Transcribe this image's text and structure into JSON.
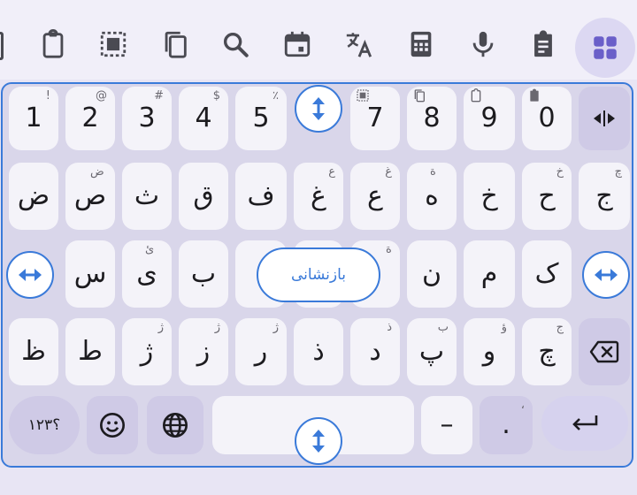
{
  "toolbar": {
    "items": [
      {
        "icon": "clipboard-icon"
      },
      {
        "icon": "select-all-icon"
      },
      {
        "icon": "copy-icon"
      },
      {
        "icon": "search-icon"
      },
      {
        "icon": "calendar-icon"
      },
      {
        "icon": "translate-icon"
      },
      {
        "icon": "calculator-icon"
      },
      {
        "icon": "microphone-icon"
      },
      {
        "icon": "clipboard-list-icon"
      },
      {
        "icon": "apps-grid-icon"
      }
    ]
  },
  "keyboard": {
    "row1": [
      {
        "main": "1",
        "hint": "!"
      },
      {
        "main": "2",
        "hint": "@"
      },
      {
        "main": "3",
        "hint": "#"
      },
      {
        "main": "4",
        "hint": "$"
      },
      {
        "main": "5",
        "hint": "٪"
      },
      {
        "main": "7",
        "hint_icon": "select-all-icon"
      },
      {
        "main": "8",
        "hint_icon": "copy-icon"
      },
      {
        "main": "9",
        "hint_icon": "clipboard-icon"
      },
      {
        "main": "0",
        "hint_icon": "clipboard-list-icon"
      }
    ],
    "row2": [
      {
        "main": "ض",
        "hint": ""
      },
      {
        "main": "ص",
        "hint": "ض"
      },
      {
        "main": "ث",
        "hint": ""
      },
      {
        "main": "ق",
        "hint": ""
      },
      {
        "main": "ف",
        "hint": ""
      },
      {
        "main": "غ",
        "hint": "ع"
      },
      {
        "main": "ع",
        "hint": "غ"
      },
      {
        "main": "ه",
        "hint": "ة"
      },
      {
        "main": "خ",
        "hint": ""
      },
      {
        "main": "ح",
        "hint": "خ"
      },
      {
        "main": "ج",
        "hint": "چ"
      }
    ],
    "row3": [
      {
        "main": "س",
        "hint": ""
      },
      {
        "main": "ی",
        "hint": "ئ"
      },
      {
        "main": "ب",
        "hint": ""
      },
      {
        "main": "ن",
        "hint": ""
      },
      {
        "main": "م",
        "hint": ""
      },
      {
        "main": "ک",
        "hint": ""
      }
    ],
    "row4": [
      {
        "main": "ظ",
        "hint": ""
      },
      {
        "main": "ط",
        "hint": ""
      },
      {
        "main": "ژ",
        "hint": "ژ"
      },
      {
        "main": "ز",
        "hint": "ژ"
      },
      {
        "main": "ر",
        "hint": "ژ"
      },
      {
        "main": "ذ",
        "hint": ""
      },
      {
        "main": "د",
        "hint": "ذ"
      },
      {
        "main": "پ",
        "hint": "ب"
      },
      {
        "main": "و",
        "hint": "ؤ"
      },
      {
        "main": "چ",
        "hint": "ج"
      }
    ],
    "row5": {
      "numbers_label": "۱۲۳؟",
      "dash_label": "–",
      "period_label": ".",
      "period_hint": "،"
    },
    "reset_label": "بازنشانی",
    "hidden_key_hint": "ة"
  },
  "colors": {
    "accent": "#3a7ad9",
    "key_bg": "#f4f3f9",
    "key_dark_bg": "#cfcae6",
    "keyboard_bg": "#d9d6ea"
  }
}
